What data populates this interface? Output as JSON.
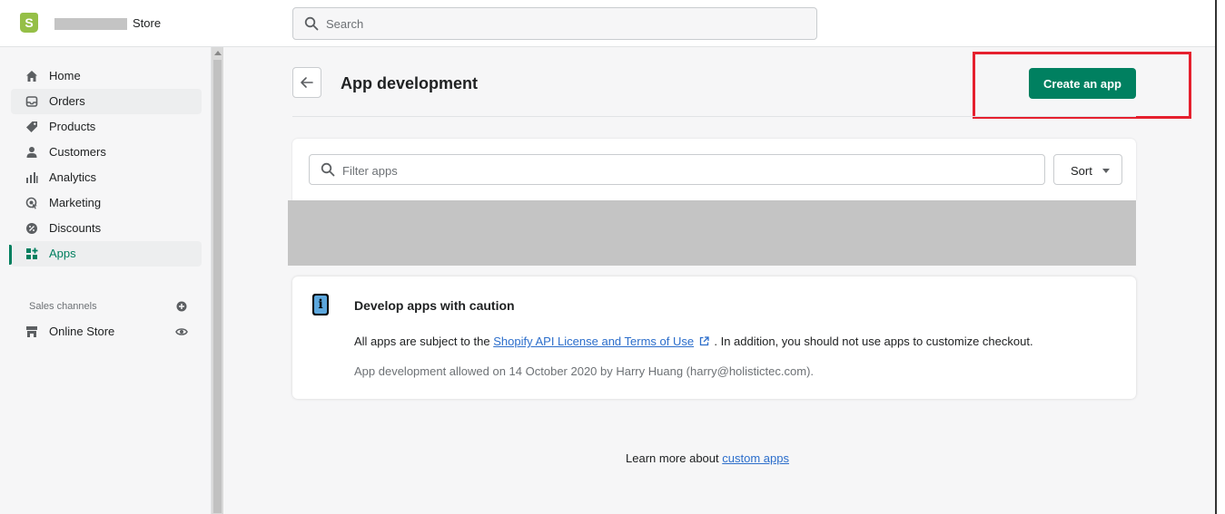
{
  "header": {
    "store_suffix": "Store",
    "search_placeholder": "Search"
  },
  "sidebar": {
    "items": [
      {
        "label": "Home"
      },
      {
        "label": "Orders"
      },
      {
        "label": "Products"
      },
      {
        "label": "Customers"
      },
      {
        "label": "Analytics"
      },
      {
        "label": "Marketing"
      },
      {
        "label": "Discounts"
      },
      {
        "label": "Apps"
      }
    ],
    "sales_channels_label": "Sales channels",
    "online_store_label": "Online Store"
  },
  "page": {
    "title": "App development",
    "create_button": "Create an app",
    "filter_placeholder": "Filter apps",
    "sort_label": "Sort"
  },
  "info_card": {
    "title": "Develop apps with caution",
    "text_prefix": "All apps are subject to the",
    "link_text": "Shopify API License and Terms of Use",
    "text_suffix": ". In addition, you should not use apps to customize checkout.",
    "meta": "App development allowed on 14 October 2020 by Harry Huang (harry@holistictec.com)."
  },
  "footer": {
    "learn_prefix": "Learn more about",
    "learn_link": "custom apps"
  },
  "colors": {
    "primary": "#008060",
    "highlight": "#e5202e",
    "link": "#2c6ecb"
  }
}
